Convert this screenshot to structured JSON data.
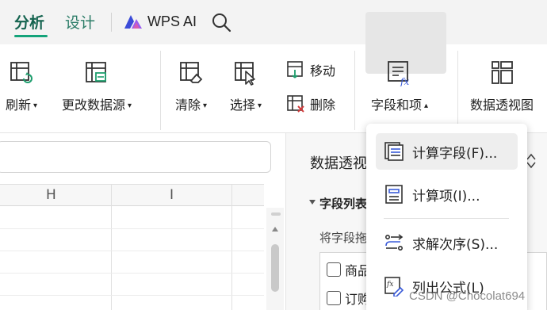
{
  "tabs": {
    "analyze": "分析",
    "design": "设计",
    "wps_ai": "WPS AI"
  },
  "ribbon": {
    "refresh": "刷新",
    "change_source": "更改数据源",
    "clear": "清除",
    "select": "选择",
    "move": "移动",
    "delete": "删除",
    "fields_items": "字段和项",
    "pivot_chart": "数据透视图"
  },
  "sheet": {
    "columns": [
      "H",
      "I"
    ]
  },
  "pivot_panel": {
    "title": "数据透视",
    "section": "字段列表",
    "hint": "将字段拖",
    "fields": [
      "商品",
      "订购"
    ]
  },
  "dropdown": {
    "items": [
      "计算字段(F)...",
      "计算项(I)...",
      "求解次序(S)...",
      "列出公式(L)"
    ]
  },
  "watermark": "CSDN @Chocolat694",
  "colors": {
    "accent": "#14a37a",
    "tab_active": "#14634f",
    "icon_green": "#1f9e6e",
    "icon_red": "#d23b3b",
    "icon_blue": "#3a5bd9"
  }
}
